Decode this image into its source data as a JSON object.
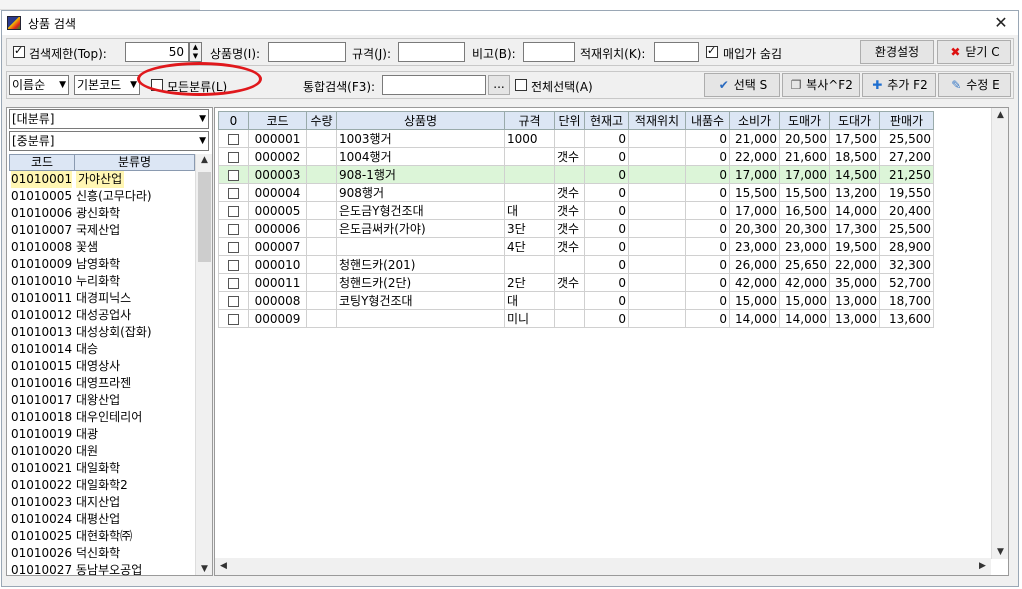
{
  "window": {
    "title": "상품 검색",
    "close_glyph": "✕"
  },
  "row1": {
    "limit_label": "검색제한(Top):",
    "limit_value": "50",
    "name_label": "상품명(I):",
    "spec_label": "규격(J):",
    "note_label": "비고(B):",
    "location_label": "적재위치(K):",
    "hide_price_label": "매입가 숨김",
    "settings_button": "환경설정",
    "close_button": "닫기 C"
  },
  "row2": {
    "sort_combo": "이름순",
    "code_combo": "기본코드",
    "all_category_label": "모든분류(L)",
    "combined_search_label": "통합검색(F3):",
    "ellipsis_button": "...",
    "select_all_label": "전체선택(A)",
    "select_button": "선택 S",
    "copy_button": "복사^F2",
    "add_button": "추가 F2",
    "edit_button": "수정 E"
  },
  "left": {
    "major_combo": "[대분류]",
    "middle_combo": "[중분류]",
    "headers": [
      "코드",
      "분류명"
    ],
    "rows": [
      [
        "01010001",
        "가야산업"
      ],
      [
        "01010005",
        "신흥(고무다라)"
      ],
      [
        "01010006",
        "광신화학"
      ],
      [
        "01010007",
        "국제산업"
      ],
      [
        "01010008",
        "꽃샘"
      ],
      [
        "01010009",
        "남영화학"
      ],
      [
        "01010010",
        "누리화학"
      ],
      [
        "01010011",
        "대경피닉스"
      ],
      [
        "01010012",
        "대성공업사"
      ],
      [
        "01010013",
        "대성상회(잡화)"
      ],
      [
        "01010014",
        "대승"
      ],
      [
        "01010015",
        "대영상사"
      ],
      [
        "01010016",
        "대영프라젠"
      ],
      [
        "01010017",
        "대왕산업"
      ],
      [
        "01010018",
        "대우인테리어"
      ],
      [
        "01010019",
        "대광"
      ],
      [
        "01010020",
        "대원"
      ],
      [
        "01010021",
        "대일화학"
      ],
      [
        "01010022",
        "대일화학2"
      ],
      [
        "01010023",
        "대지산업"
      ],
      [
        "01010024",
        "대평산업"
      ],
      [
        "01010025",
        "대현화학㈜"
      ],
      [
        "01010026",
        "덕신화학"
      ],
      [
        "01010027",
        "동남부오공업"
      ]
    ]
  },
  "grid": {
    "headers": [
      "0",
      "코드",
      "수량",
      "상품명",
      "규격",
      "단위",
      "현재고",
      "적재위치",
      "내품수",
      "소비가",
      "도매가",
      "도대가",
      "판매가"
    ],
    "rows": [
      {
        "code": "000001",
        "qty": "",
        "name": "1003행거",
        "spec": "1000",
        "unit": "",
        "stock": "0",
        "loc": "",
        "inner": "0",
        "consumer": "21,000",
        "wholesale": "20,500",
        "dodae": "17,500",
        "sale": "25,500"
      },
      {
        "code": "000002",
        "qty": "",
        "name": "1004행거",
        "spec": "",
        "unit": "갯수",
        "stock": "0",
        "loc": "",
        "inner": "0",
        "consumer": "22,000",
        "wholesale": "21,600",
        "dodae": "18,500",
        "sale": "27,200"
      },
      {
        "code": "000003",
        "qty": "",
        "name": "908-1행거",
        "spec": "",
        "unit": "",
        "stock": "0",
        "loc": "",
        "inner": "0",
        "consumer": "17,000",
        "wholesale": "17,000",
        "dodae": "14,500",
        "sale": "21,250"
      },
      {
        "code": "000004",
        "qty": "",
        "name": "908행거",
        "spec": "",
        "unit": "갯수",
        "stock": "0",
        "loc": "",
        "inner": "0",
        "consumer": "15,500",
        "wholesale": "15,500",
        "dodae": "13,200",
        "sale": "19,550"
      },
      {
        "code": "000005",
        "qty": "",
        "name": "은도금Y형건조대",
        "spec": "대",
        "unit": "갯수",
        "stock": "0",
        "loc": "",
        "inner": "0",
        "consumer": "17,000",
        "wholesale": "16,500",
        "dodae": "14,000",
        "sale": "20,400"
      },
      {
        "code": "000006",
        "qty": "",
        "name": "은도금써카(가야)",
        "spec": "3단",
        "unit": "갯수",
        "stock": "0",
        "loc": "",
        "inner": "0",
        "consumer": "20,300",
        "wholesale": "20,300",
        "dodae": "17,300",
        "sale": "25,500"
      },
      {
        "code": "000007",
        "qty": "",
        "name": "",
        "spec": "4단",
        "unit": "갯수",
        "stock": "0",
        "loc": "",
        "inner": "0",
        "consumer": "23,000",
        "wholesale": "23,000",
        "dodae": "19,500",
        "sale": "28,900"
      },
      {
        "code": "000010",
        "qty": "",
        "name": "청핸드카(201)",
        "spec": "",
        "unit": "",
        "stock": "0",
        "loc": "",
        "inner": "0",
        "consumer": "26,000",
        "wholesale": "25,650",
        "dodae": "22,000",
        "sale": "32,300"
      },
      {
        "code": "000011",
        "qty": "",
        "name": "청핸드카(2단)",
        "spec": "2단",
        "unit": "갯수",
        "stock": "0",
        "loc": "",
        "inner": "0",
        "consumer": "42,000",
        "wholesale": "42,000",
        "dodae": "35,000",
        "sale": "52,700"
      },
      {
        "code": "000008",
        "qty": "",
        "name": "코팅Y형건조대",
        "spec": "대",
        "unit": "",
        "stock": "0",
        "loc": "",
        "inner": "0",
        "consumer": "15,000",
        "wholesale": "15,000",
        "dodae": "13,000",
        "sale": "18,700"
      },
      {
        "code": "000009",
        "qty": "",
        "name": "",
        "spec": "미니",
        "unit": "",
        "stock": "0",
        "loc": "",
        "inner": "0",
        "consumer": "14,000",
        "wholesale": "14,000",
        "dodae": "13,000",
        "sale": "13,600"
      }
    ]
  },
  "colors": {
    "header_bg": "#dce6f4",
    "highlight_row": "#dcf5d8",
    "selected_cell": "#fff6b3",
    "annotation": "#e0181c"
  }
}
